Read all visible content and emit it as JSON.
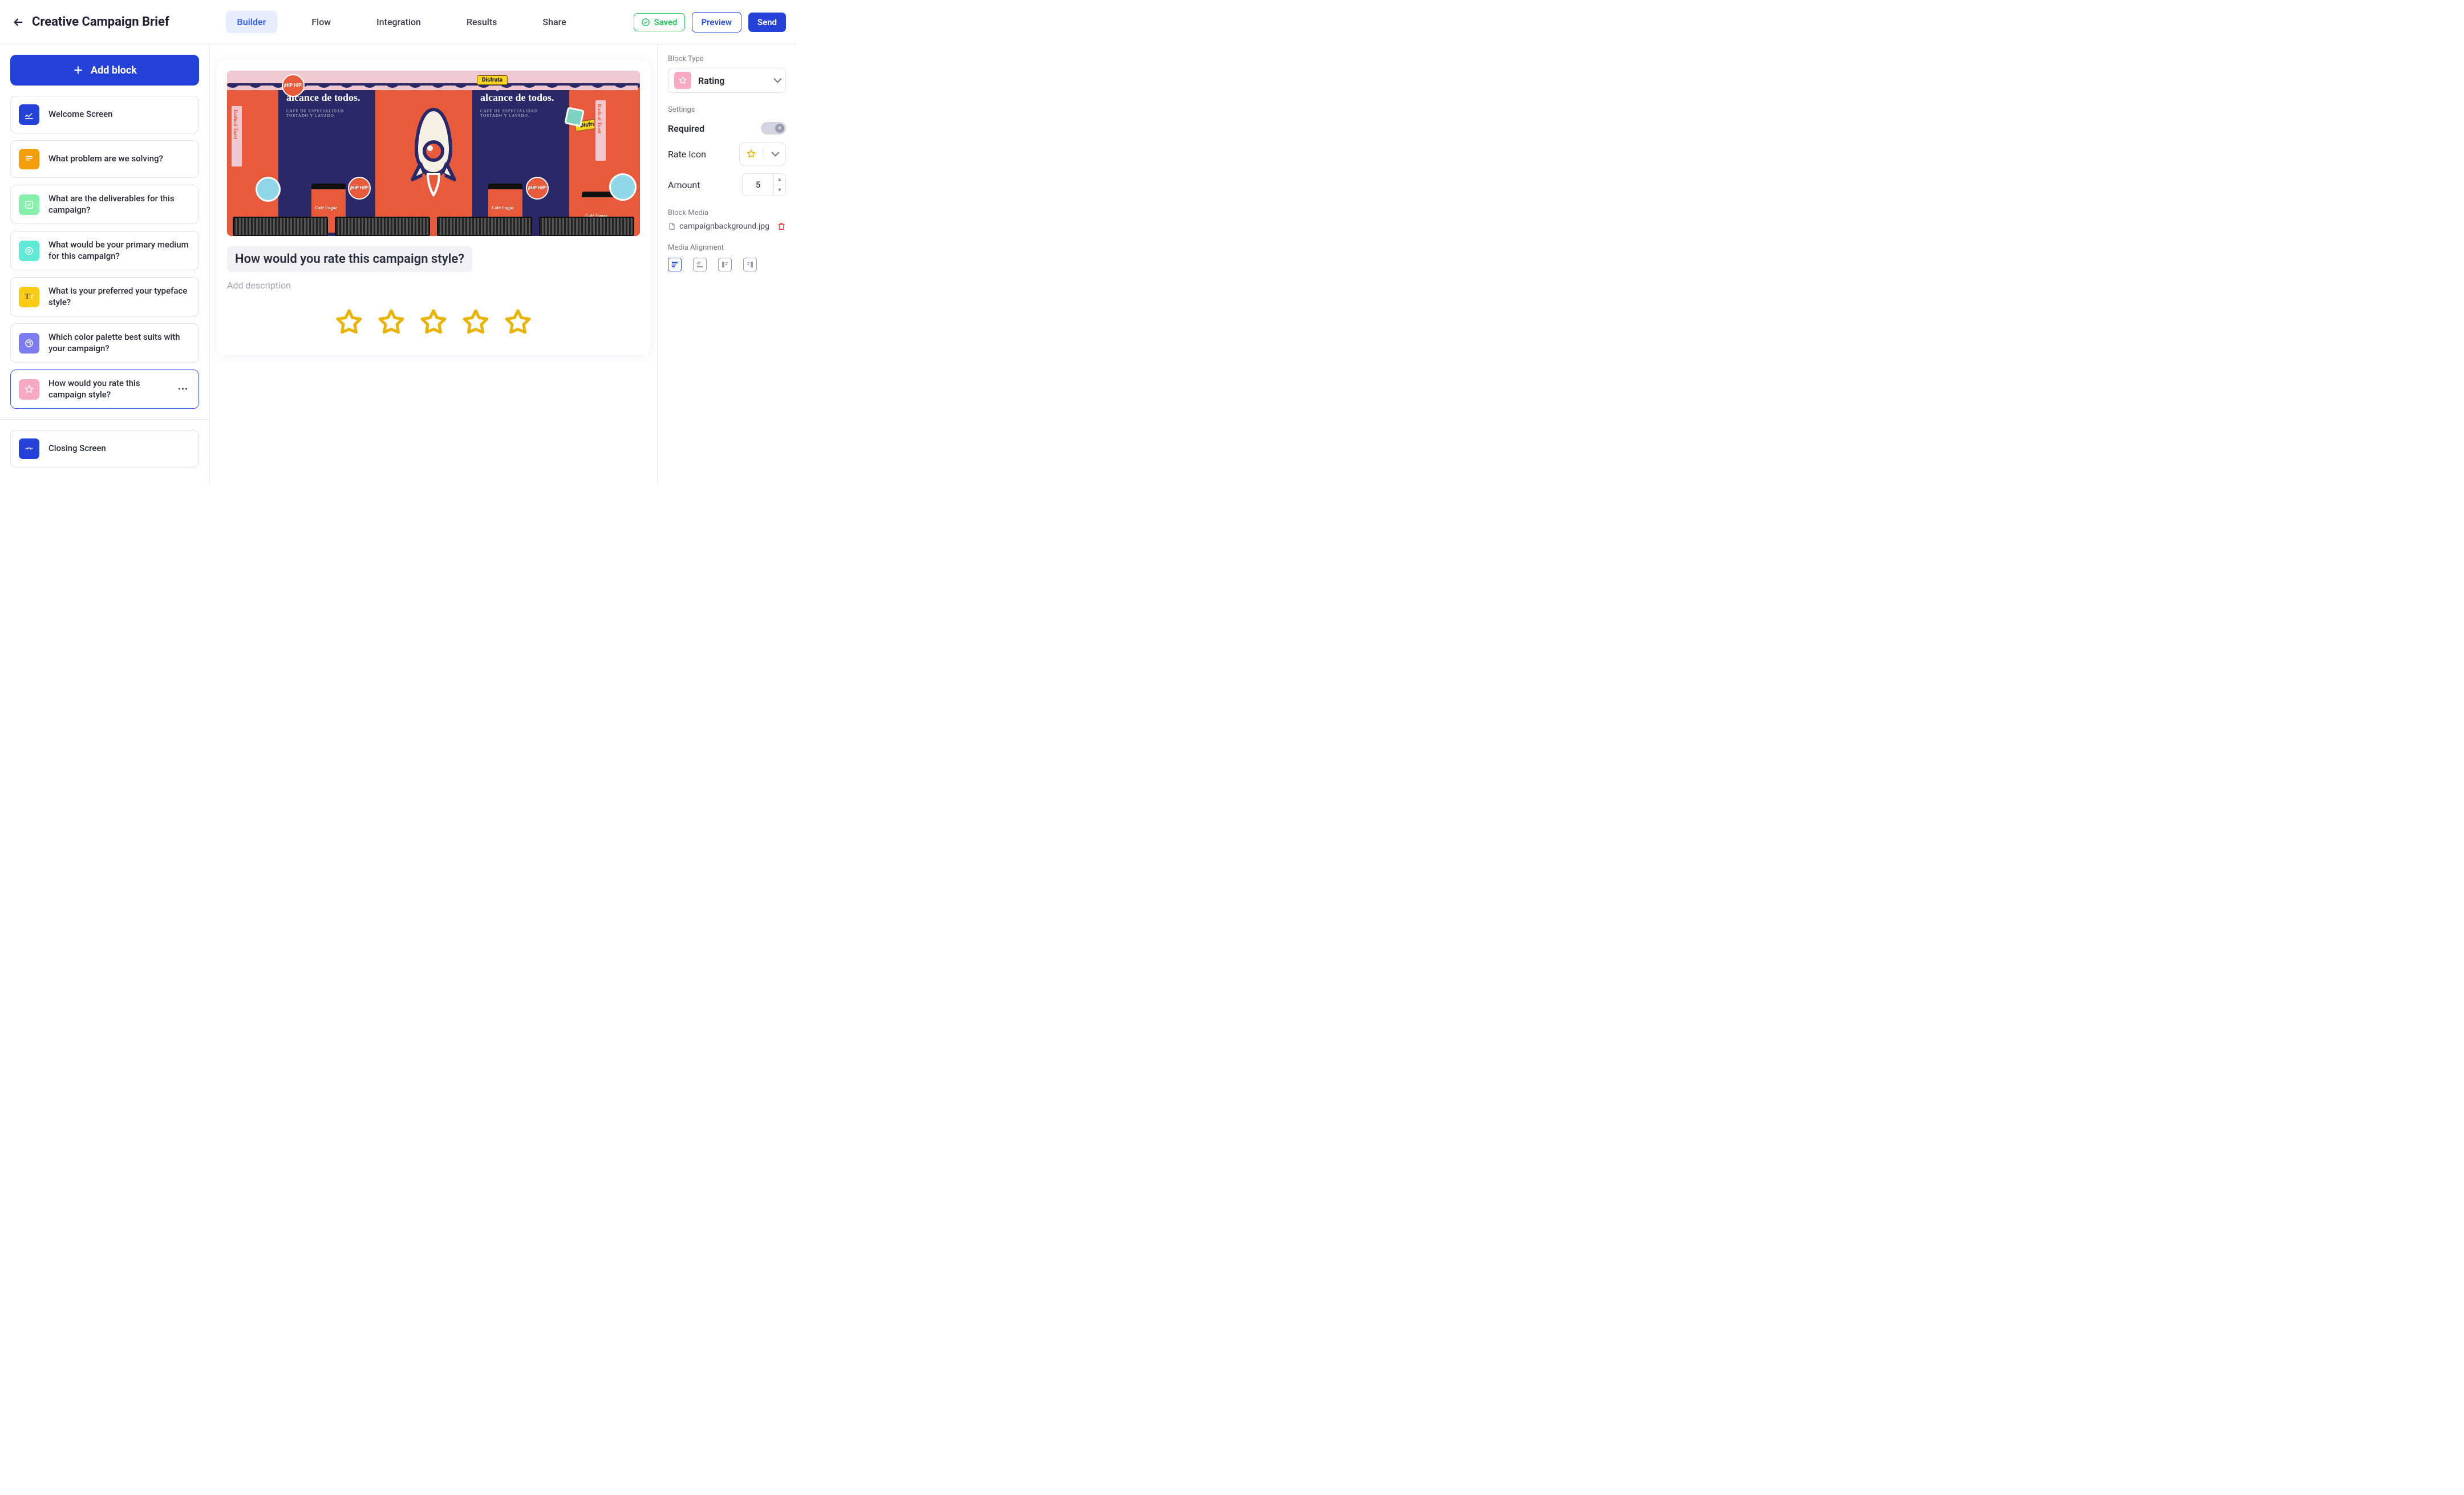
{
  "header": {
    "title": "Creative Campaign Brief",
    "tabs": {
      "builder": "Builder",
      "flow": "Flow",
      "integration": "Integration",
      "results": "Results",
      "share": "Share"
    },
    "saved": "Saved",
    "preview": "Preview",
    "send": "Send"
  },
  "sidebar": {
    "add_block": "Add block",
    "blocks": [
      {
        "label": "Welcome Screen"
      },
      {
        "label": "What problem are we solving?"
      },
      {
        "label": "What are the deliverables for this campaign?"
      },
      {
        "label": "What would be your primary medium for this campaign?"
      },
      {
        "label": "What is your preferred your typeface style?"
      },
      {
        "label": "Which color palette best suits with your campaign?"
      },
      {
        "label": "How would you rate this campaign style?"
      }
    ],
    "closing": "Closing Screen"
  },
  "canvas": {
    "question": "How would you rate this campaign style?",
    "desc_placeholder": "Add description",
    "hero": {
      "poster_headline": "Un placer al alcance de todos.",
      "poster_sub": "CAFÉ DE ESPECIALIDAD TOSTADO Y LAVADO.",
      "center_sub": "CAFÉ DE ESPECIALIDAD TOSTADO Y LAVADO",
      "pill": "Disfruta",
      "hiphip": "¡HIP HIP!",
      "bag_label": "Café Fugaz",
      "side_text": "Radical Toast"
    }
  },
  "inspector": {
    "block_type_label": "Block Type",
    "block_type_value": "Rating",
    "settings_label": "Settings",
    "required_label": "Required",
    "rate_icon_label": "Rate Icon",
    "amount_label": "Amount",
    "amount_value": "5",
    "block_media_label": "Block Media",
    "media_filename": "campaignbackground.jpg",
    "media_alignment_label": "Media Alignment"
  }
}
